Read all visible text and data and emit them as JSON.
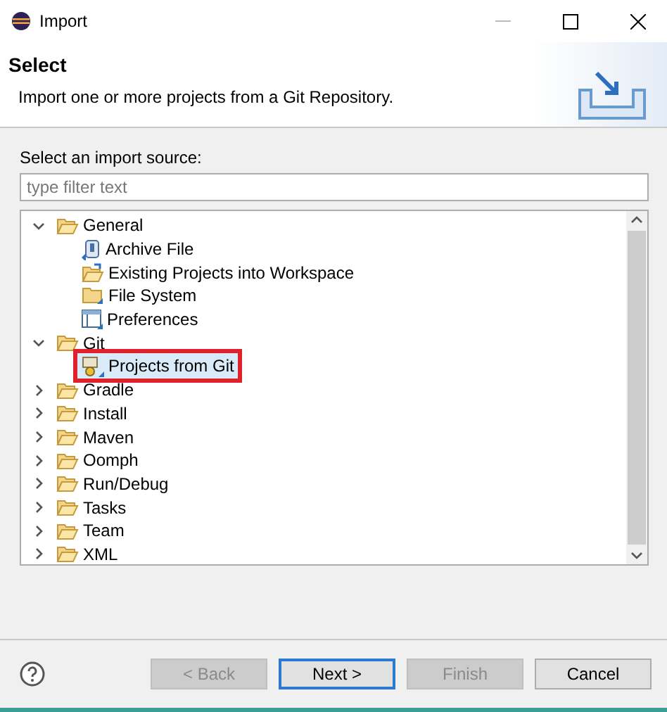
{
  "window": {
    "title": "Import"
  },
  "header": {
    "title": "Select",
    "description": "Import one or more projects from a Git Repository."
  },
  "source_label": "Select an import source:",
  "filter": {
    "placeholder": "type filter text"
  },
  "tree": [
    {
      "label": "General",
      "kind": "folder",
      "expanded": true,
      "selected": false,
      "children": [
        {
          "label": "Archive File",
          "kind": "archive",
          "selected": false
        },
        {
          "label": "Existing Projects into Workspace",
          "kind": "existing",
          "selected": false
        },
        {
          "label": "File System",
          "kind": "filesystem",
          "selected": false
        },
        {
          "label": "Preferences",
          "kind": "preferences",
          "selected": false
        }
      ]
    },
    {
      "label": "Git",
      "kind": "folder",
      "expanded": true,
      "selected": false,
      "children": [
        {
          "label": "Projects from Git",
          "kind": "git",
          "selected": true
        }
      ]
    },
    {
      "label": "Gradle",
      "kind": "folder",
      "expanded": false,
      "selected": false
    },
    {
      "label": "Install",
      "kind": "folder",
      "expanded": false,
      "selected": false
    },
    {
      "label": "Maven",
      "kind": "folder",
      "expanded": false,
      "selected": false
    },
    {
      "label": "Oomph",
      "kind": "folder",
      "expanded": false,
      "selected": false
    },
    {
      "label": "Run/Debug",
      "kind": "folder",
      "expanded": false,
      "selected": false
    },
    {
      "label": "Tasks",
      "kind": "folder",
      "expanded": false,
      "selected": false
    },
    {
      "label": "Team",
      "kind": "folder",
      "expanded": false,
      "selected": false
    },
    {
      "label": "XML",
      "kind": "folder",
      "expanded": false,
      "selected": false
    }
  ],
  "buttons": [
    {
      "label": "< Back",
      "disabled": true,
      "default": false
    },
    {
      "label": "Next >",
      "disabled": false,
      "default": true
    },
    {
      "label": "Finish",
      "disabled": true,
      "default": false
    },
    {
      "label": "Cancel",
      "disabled": false,
      "default": false
    }
  ]
}
